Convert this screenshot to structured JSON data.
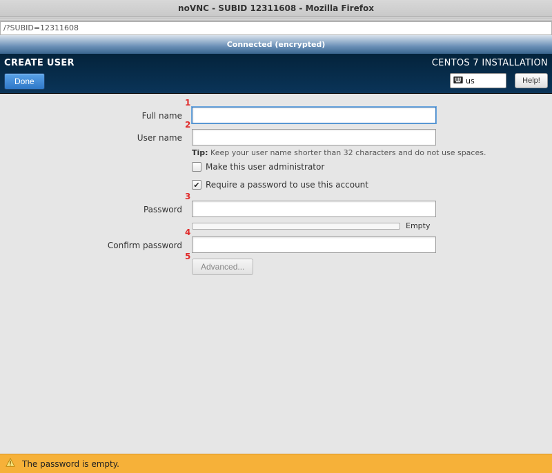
{
  "browser": {
    "title": "noVNC - SUBID 12311608 - Mozilla Firefox",
    "url": "/?SUBID=12311608"
  },
  "vnc_status": "Connected (encrypted)",
  "header": {
    "page_title": "CREATE USER",
    "done_label": "Done",
    "install_title": "CENTOS 7 INSTALLATION",
    "kbd_layout": "us",
    "help_label": "Help!"
  },
  "annotations": {
    "n1": "1",
    "n2": "2",
    "n3": "3",
    "n4": "4",
    "n5": "5"
  },
  "form": {
    "full_name_label": "Full name",
    "full_name_value": "",
    "user_name_label": "User name",
    "user_name_value": "",
    "tip_prefix": "Tip:",
    "tip_text": " Keep your user name shorter than 32 characters and do not use spaces.",
    "admin_label": "Make this user administrator",
    "admin_checked": false,
    "require_pw_label": "Require a password to use this account",
    "require_pw_checked": true,
    "password_label": "Password",
    "password_value": "",
    "confirm_label": "Confirm password",
    "confirm_value": "",
    "strength_label": "Empty",
    "advanced_label": "Advanced..."
  },
  "warning": {
    "text": "The password is empty."
  }
}
